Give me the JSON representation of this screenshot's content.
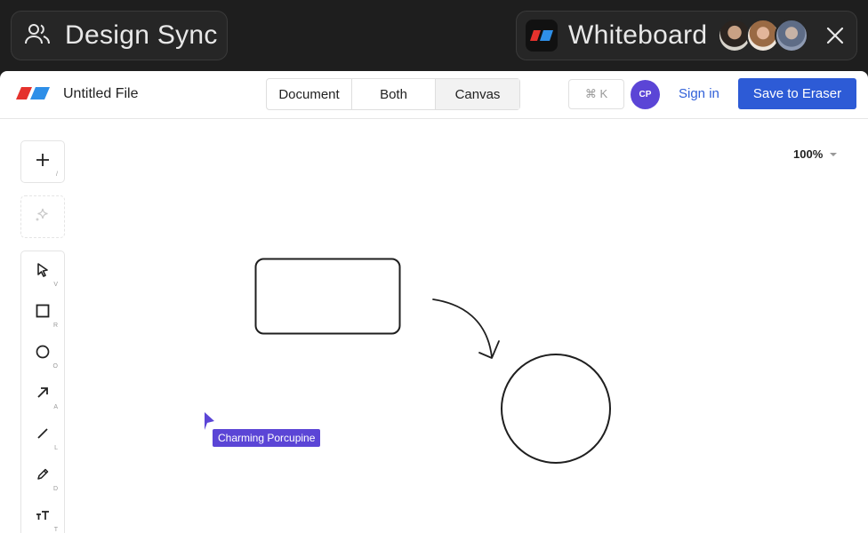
{
  "meeting": {
    "title": "Design Sync",
    "app_name": "Whiteboard"
  },
  "toolbar": {
    "file_name": "Untitled File",
    "view_modes": [
      "Document",
      "Both",
      "Canvas"
    ],
    "active_mode": "Canvas",
    "command_shortcut": "⌘ K",
    "user_initials": "CP",
    "sign_in": "Sign in",
    "save_button": "Save to Eraser"
  },
  "zoom": "100%",
  "tools": [
    {
      "icon": "plus-icon",
      "key": "/"
    },
    {
      "icon": "sparkle-icon",
      "key": ""
    },
    {
      "icon": "select-pointer-icon",
      "key": "V"
    },
    {
      "icon": "rectangle-icon",
      "key": "R"
    },
    {
      "icon": "circle-icon",
      "key": "O"
    },
    {
      "icon": "arrow-icon",
      "key": "A"
    },
    {
      "icon": "line-icon",
      "key": "L"
    },
    {
      "icon": "pencil-icon",
      "key": "D"
    },
    {
      "icon": "text-icon",
      "key": "T"
    }
  ],
  "collaborator_cursor": "Charming Porcupine",
  "colors": {
    "accent": "#2d5bd6",
    "collaborator": "#5b45d6"
  }
}
